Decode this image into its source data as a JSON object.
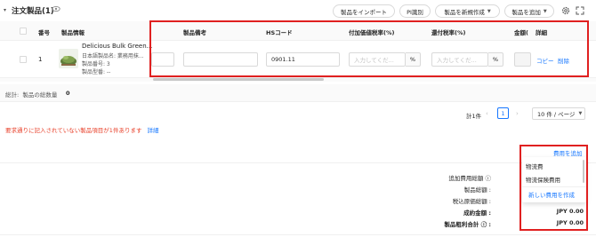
{
  "header": {
    "title": "注文製品(1)",
    "import_label": "製品をインポート",
    "pi_label": "PI識別",
    "new_product_label": "製品を新規作成",
    "add_product_label": "製品を追加"
  },
  "table": {
    "columns": {
      "index": "番号",
      "info": "製品情報",
      "remark": "製品備考",
      "hs_code": "HSコード",
      "vat_rate": "付加価値税率(%)",
      "rebate_rate": "還付税率(%)",
      "amount": "金額(",
      "details": "詳細"
    },
    "row": {
      "index": "1",
      "product_name": "Delicious Bulk Green...",
      "jp_name": "日本語製品名: 業務用抹...",
      "product_no": "製品番号: 3",
      "model": "製品型番: --",
      "hs_code_value": "0901.11",
      "vat_placeholder": "入力してくだ...",
      "rebate_placeholder": "入力してくだ...",
      "pct_unit": "%",
      "copy_label": "コピー",
      "delete_label": "削除"
    }
  },
  "summary_line": {
    "label": "総計:  製品の総数量",
    "value": "0"
  },
  "pagination": {
    "total": "計1件",
    "current_page": "1",
    "page_size": "10 件 / ページ"
  },
  "warning": {
    "text": "要求通りに記入されていない製品項目が1件あります",
    "link": "詳細"
  },
  "totals": {
    "labels": [
      "追加費用総額 ⓘ",
      "製品総額 :",
      "税込原価総額 :",
      "成約金額 :",
      "製品粗利合計 ⓘ :"
    ],
    "values": [
      "",
      "",
      "",
      "JPY 0.00",
      "JPY 0.00"
    ]
  },
  "fee_dropdown": {
    "add_fee_link": "費用を追加",
    "options": [
      "物流費",
      "物流保険費用"
    ],
    "create_label": "新しい費用を作成"
  },
  "colors": {
    "accent": "#1677ff",
    "highlight": "#e02020",
    "warning_text": "#e8402a"
  }
}
